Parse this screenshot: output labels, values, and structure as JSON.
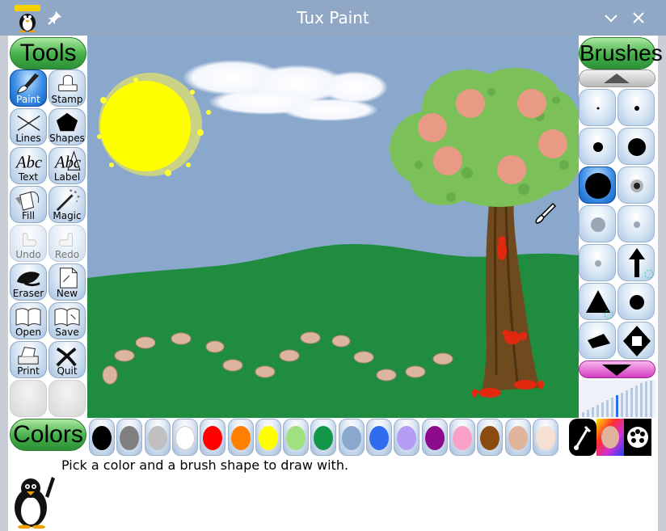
{
  "window": {
    "title": "Tux Paint"
  },
  "tools": {
    "header": "Tools",
    "items": [
      {
        "label": "Paint",
        "icon": "paintbrush-icon",
        "selected": true
      },
      {
        "label": "Stamp",
        "icon": "stamp-icon"
      },
      {
        "label": "Lines",
        "icon": "lines-icon"
      },
      {
        "label": "Shapes",
        "icon": "pentagon-icon"
      },
      {
        "label": "Text",
        "icon": "text-abc-icon"
      },
      {
        "label": "Label",
        "icon": "label-abc-icon"
      },
      {
        "label": "Fill",
        "icon": "paint-bucket-icon"
      },
      {
        "label": "Magic",
        "icon": "magic-wand-icon"
      },
      {
        "label": "Undo",
        "icon": "undo-hand-icon",
        "disabled": true
      },
      {
        "label": "Redo",
        "icon": "redo-hand-icon",
        "disabled": true
      },
      {
        "label": "Eraser",
        "icon": "eraser-icon"
      },
      {
        "label": "New",
        "icon": "new-document-icon"
      },
      {
        "label": "Open",
        "icon": "open-book-icon"
      },
      {
        "label": "Save",
        "icon": "save-book-icon"
      },
      {
        "label": "Print",
        "icon": "printer-icon"
      },
      {
        "label": "Quit",
        "icon": "quit-x-icon"
      }
    ]
  },
  "brushes": {
    "header": "Brushes",
    "items": [
      {
        "icon": "brush-tiny-dot-icon"
      },
      {
        "icon": "brush-small-dot-icon"
      },
      {
        "icon": "brush-medium-dot-icon"
      },
      {
        "icon": "brush-large-dot-icon"
      },
      {
        "icon": "brush-huge-dot-icon",
        "selected": true
      },
      {
        "icon": "brush-fuzzy-dot-icon"
      },
      {
        "icon": "brush-soft-gray-icon"
      },
      {
        "icon": "brush-soft-small-icon"
      },
      {
        "icon": "brush-soft-tiny-icon"
      },
      {
        "icon": "brush-arrow-up-icon"
      },
      {
        "icon": "brush-triangle-icon"
      },
      {
        "icon": "brush-round-dot-icon"
      },
      {
        "icon": "brush-parallelogram-icon"
      },
      {
        "icon": "brush-diamond-icon"
      }
    ]
  },
  "colors": {
    "header": "Colors",
    "swatches": [
      {
        "name": "black",
        "hex": "#000000"
      },
      {
        "name": "gray",
        "hex": "#808080"
      },
      {
        "name": "silver",
        "hex": "#c0c0c0"
      },
      {
        "name": "white",
        "hex": "#ffffff"
      },
      {
        "name": "red",
        "hex": "#ff0000"
      },
      {
        "name": "orange",
        "hex": "#ff8000"
      },
      {
        "name": "yellow",
        "hex": "#ffff00"
      },
      {
        "name": "light-green",
        "hex": "#a0e080"
      },
      {
        "name": "green",
        "hex": "#14964a"
      },
      {
        "name": "sky-blue",
        "hex": "#8aa8cc"
      },
      {
        "name": "blue",
        "hex": "#2f6cf0"
      },
      {
        "name": "lavender",
        "hex": "#b59cf5"
      },
      {
        "name": "purple",
        "hex": "#8c0a8c"
      },
      {
        "name": "pink",
        "hex": "#f8a0c8"
      },
      {
        "name": "brown",
        "hex": "#8a4a10"
      },
      {
        "name": "tan",
        "hex": "#e0b49c"
      },
      {
        "name": "beige",
        "hex": "#f6e0d2"
      }
    ],
    "special": [
      "color-picker-icon",
      "rainbow-palette-icon",
      "color-mixer-icon"
    ]
  },
  "status": {
    "message": "Pick a color and a brush shape to draw with."
  },
  "canvas": {
    "sky_color": "#8aa8cc",
    "grass_color": "#1f8c3f",
    "sun_color": "#ffff00",
    "tree_trunk_color": "#6e4a1e",
    "leaf_color": "#7cc05a",
    "fruit_color": "#e89a84"
  }
}
